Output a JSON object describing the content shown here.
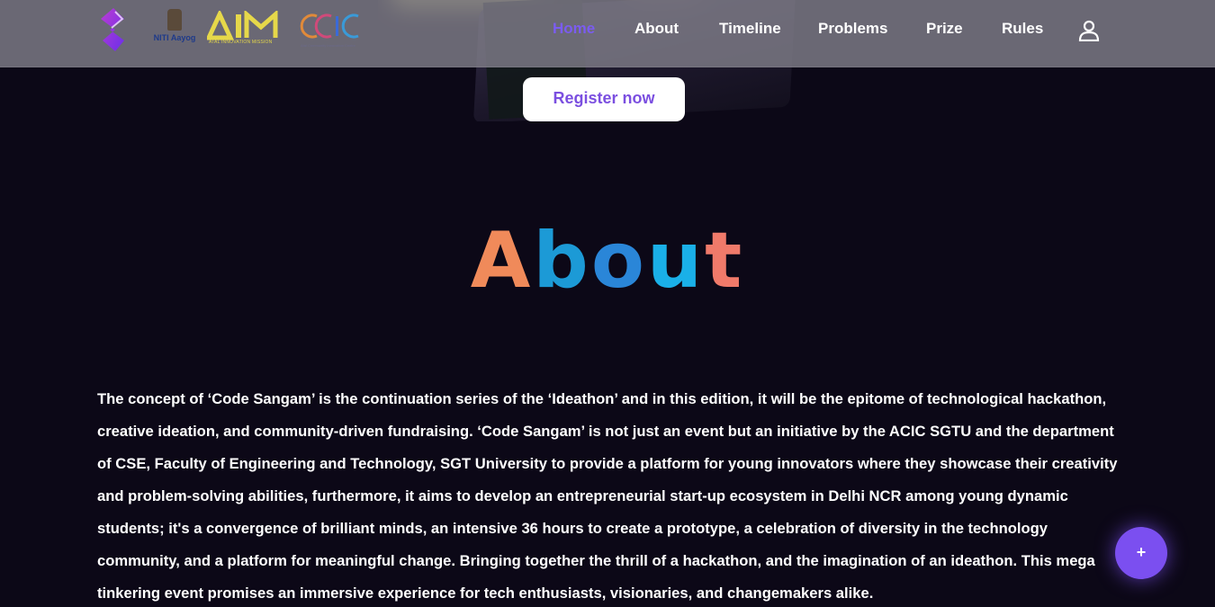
{
  "header": {
    "logos": {
      "main": "code-sangam-logo",
      "niti_label": "NITI Aayog",
      "aim_label": "AIM",
      "aim_sub": "ATAL INNOVATION MISSION",
      "acic_label": "ACIC",
      "acic_sub": "Atal Community Innovation Centre"
    },
    "nav": [
      {
        "label": "Home",
        "active": true
      },
      {
        "label": "About",
        "active": false
      },
      {
        "label": "Timeline",
        "active": false
      },
      {
        "label": "Problems",
        "active": false
      },
      {
        "label": "Prize",
        "active": false
      },
      {
        "label": "Rules",
        "active": false
      }
    ],
    "user_icon": "user-icon"
  },
  "hero": {
    "register_label": "Register now"
  },
  "about": {
    "title": "About",
    "title_letters": [
      "A",
      "b",
      "o",
      "u",
      "t"
    ],
    "text": "The concept of ‘Code Sangam’ is the continuation series of the ‘Ideathon’ and in this edition, it will be the epitome of technological hackathon, creative ideation, and community-driven fundraising. ‘Code Sangam’ is not just an event but an initiative by the ACIC SGTU and the department of CSE, Faculty of Engineering and Technology, SGT University to provide a platform for young innovators where they showcase their creativity and problem-solving abilities, furthermore, it aims to develop an entrepreneurial start-up ecosystem in Delhi NCR among young dynamic students; it's a convergence of brilliant minds, an intensive 36 hours to create a prototype, a celebration of diversity in the technology community, and a platform for meaningful change. Bringing together the thrill of a hackathon, and the imagination of an ideathon. This mega tinkering event promises an immersive experience for tech enthusiasts, visionaries, and changemakers alike."
  },
  "fab": {
    "label": "+"
  },
  "colors": {
    "accent": "#7b4ff0",
    "nav_active": "#7b5cf0",
    "background": "#0c0817",
    "header_bg": "#7a7884"
  }
}
